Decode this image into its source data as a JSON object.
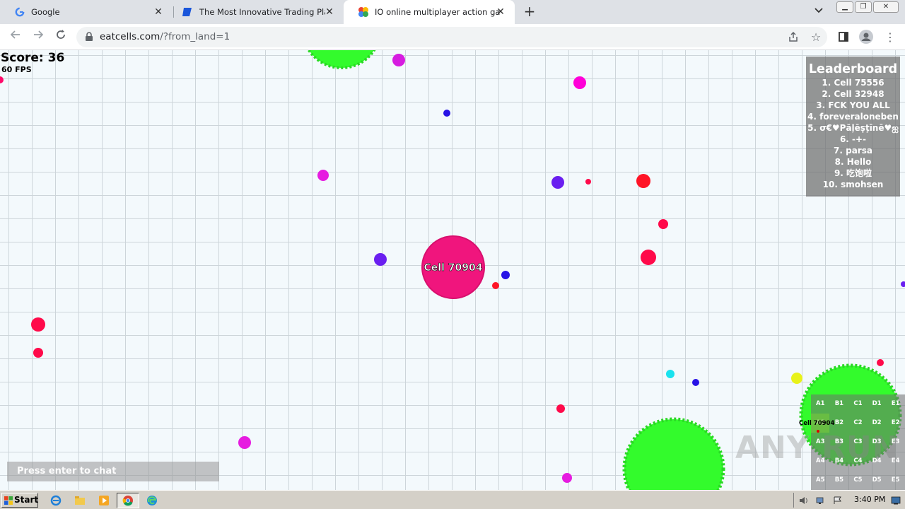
{
  "browser": {
    "tabs": [
      {
        "title": "Google",
        "favicon": "google-g-icon"
      },
      {
        "title": "The Most Innovative Trading Platform",
        "favicon": "trading-platform-icon"
      },
      {
        "title": "IO online multiplayer action game. St",
        "favicon": "eatcells-icon",
        "active": true
      }
    ],
    "url_host": "eatcells.com",
    "url_path": "/?from_land=1"
  },
  "game": {
    "score_label": "Score: 36",
    "fps_label": "60 FPS",
    "player_name": "Cell 70904",
    "player_color": "#f0157d",
    "food_colors": [
      "#ff0a6a",
      "#d61ce0",
      "#6a1ff0",
      "#2813e6",
      "#ff1426",
      "#19e2ee",
      "#e8f21a"
    ],
    "virus_color": "#33fb2c",
    "leaderboard": {
      "title": "Leaderboard",
      "entries": [
        "1. Cell 75556",
        "2. Cell 32948",
        "3. FCK YOU ALL",
        "4. foreveraloneben",
        "5. σ€♥Pāļēṣţīnē♥ஐ",
        "6. -+-",
        "7. parsa",
        "8. Hello",
        "9. 吃饱啦",
        "10. smohsen"
      ]
    },
    "chat_placeholder": "Press enter to chat",
    "minimap": {
      "cells": [
        "A1",
        "B1",
        "C1",
        "D1",
        "E1",
        "A2",
        "B2",
        "C2",
        "D2",
        "E2",
        "A3",
        "B3",
        "C3",
        "D3",
        "E3",
        "A4",
        "B4",
        "C4",
        "D4",
        "E4",
        "A5",
        "B5",
        "C5",
        "D5",
        "E5"
      ],
      "player_label": "Cell 70904"
    },
    "watermark": "ANY RUN"
  },
  "taskbar": {
    "start_label": "Start",
    "clock": "3:40 PM"
  }
}
